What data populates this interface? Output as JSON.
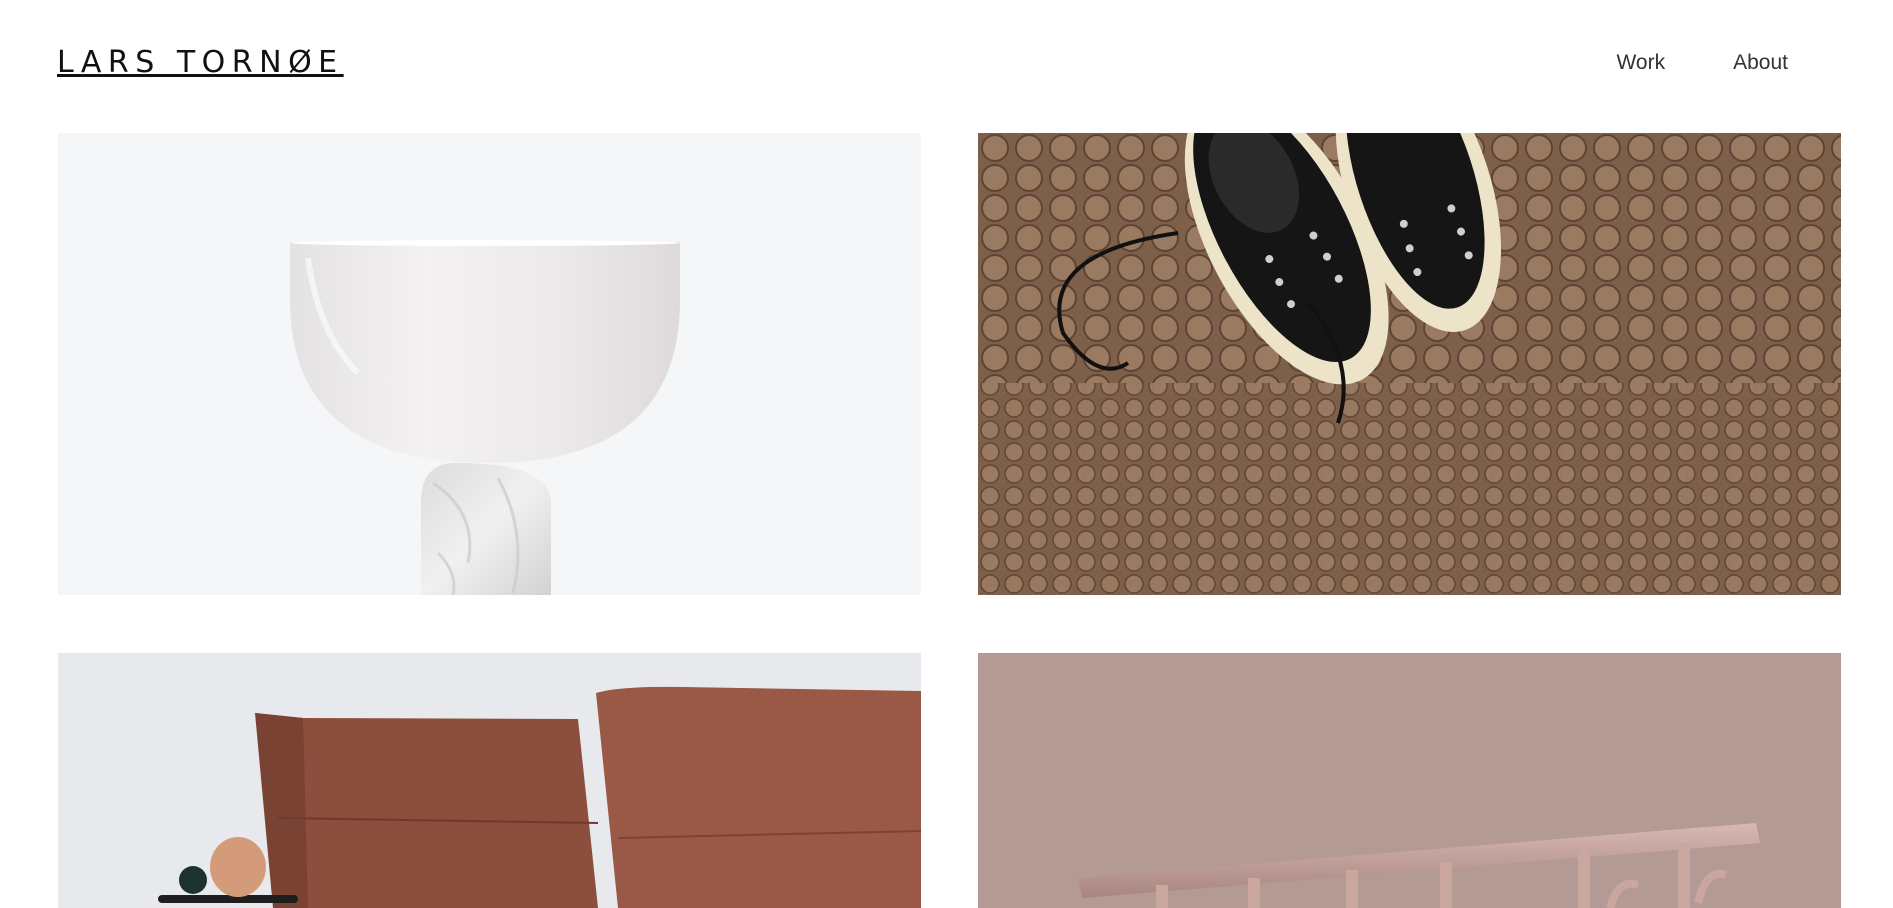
{
  "header": {
    "logo": "LARS TORNØE",
    "nav": [
      {
        "label": "Work"
      },
      {
        "label": "About"
      }
    ]
  },
  "colors": {
    "tile1_background": "#f5f6f8",
    "tile2_background": "#8a6a52",
    "tile3_background": "#e8e9ec",
    "tile4_background": "#b39a95"
  },
  "gallery": {
    "tiles": [
      {
        "icon": "white-bowl-lamp-image"
      },
      {
        "icon": "sneakers-on-doormat-image"
      },
      {
        "icon": "rust-sofa-image"
      },
      {
        "icon": "pink-coat-rack-image"
      }
    ]
  }
}
